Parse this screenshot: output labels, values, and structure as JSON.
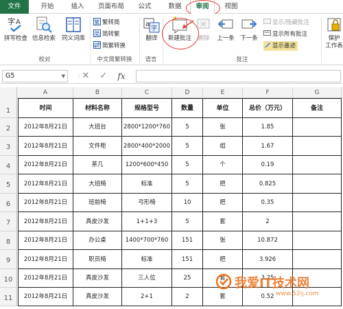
{
  "tabs": [
    "文件",
    "开始",
    "插入",
    "页面布局",
    "公式",
    "数据",
    "审阅",
    "视图"
  ],
  "active_tab": "审阅",
  "ribbon": {
    "proofing": {
      "label": "校对",
      "spell": "拼写检查",
      "research": "信息检索",
      "thesaurus": "同义词库"
    },
    "chinese": {
      "label": "中文简繁转换",
      "trad_to_simp": "繁转简",
      "simp_to_trad": "简转繁",
      "convert": "简繁转换"
    },
    "language": {
      "label": "语言",
      "translate": "翻译"
    },
    "comments": {
      "label": "批注",
      "new": "新建批注",
      "delete": "删除",
      "prev": "上一条",
      "next": "下一条",
      "show_hide": "显示/隐藏批注",
      "show_all": "显示所有批注",
      "show_ink": "显示墨迹"
    },
    "protect": {
      "line1": "保护",
      "line2": "工作表"
    }
  },
  "formula_bar": {
    "name_box": "G5",
    "cancel": "✕",
    "enter": "✓",
    "fx": "fx",
    "value": ""
  },
  "columns": [
    "A",
    "B",
    "C",
    "D",
    "E",
    "F",
    "G"
  ],
  "row_numbers": [
    "1",
    "2",
    "3",
    "4",
    "5",
    "6",
    "7",
    "8",
    "9",
    "10",
    "11"
  ],
  "table": {
    "headers": [
      "时间",
      "材料名称",
      "规格型号",
      "数量",
      "单位",
      "总价（万元）",
      "备注"
    ],
    "rows": [
      [
        "2012年8月21日",
        "大班台",
        "2800*1200*760",
        "5",
        "张",
        "1.85",
        ""
      ],
      [
        "2012年8月21日",
        "文件柜",
        "2800*400*2000",
        "5",
        "组",
        "1.67",
        ""
      ],
      [
        "2012年8月21日",
        "茶几",
        "1200*600*450",
        "5",
        "个",
        "0.19",
        ""
      ],
      [
        "2012年8月21日",
        "大班椅",
        "标准",
        "5",
        "把",
        "0.825",
        ""
      ],
      [
        "2012年8月21日",
        "班前椅",
        "弓形椅",
        "10",
        "把",
        "0.35",
        ""
      ],
      [
        "2012年8月21日",
        "真皮沙发",
        "1+1+3",
        "5",
        "套",
        "2",
        ""
      ],
      [
        "2012年8月21日",
        "办公桌",
        "1400*700*760",
        "151",
        "张",
        "10.872",
        ""
      ],
      [
        "2012年8月21日",
        "职员椅",
        "标准",
        "151",
        "把",
        "3.926",
        ""
      ],
      [
        "2012年8月21日",
        "真皮沙发",
        "三人位",
        "25",
        "套",
        "3.25",
        ""
      ],
      [
        "2012年8月21日",
        "真皮沙发",
        "2+1",
        "2",
        "套",
        "0.52",
        ""
      ]
    ]
  },
  "watermark": {
    "text": "我爱IT技术网",
    "url": "www.52ij.com"
  },
  "colors": {
    "accent": "#217346",
    "highlight_circle": "#e53935"
  }
}
